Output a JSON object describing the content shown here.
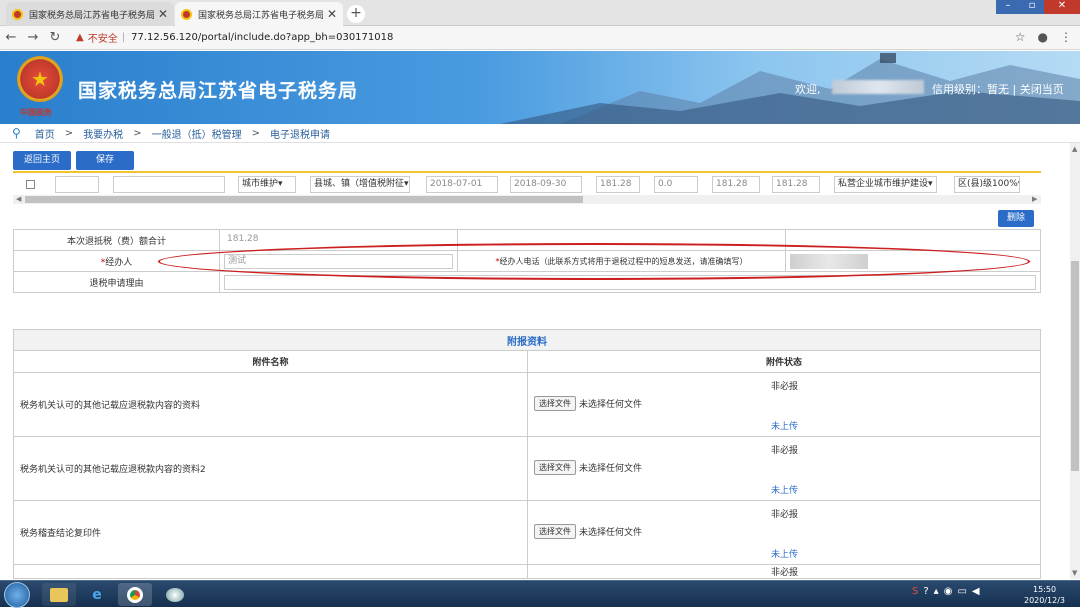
{
  "browser": {
    "tabs": [
      {
        "title": "国家税务总局江苏省电子税务局",
        "active": false
      },
      {
        "title": "国家税务总局江苏省电子税务局",
        "active": true
      }
    ],
    "new_tab_label": "+",
    "security_label": "不安全",
    "url": "77.12.56.120/portal/include.do?app_bh=030171018"
  },
  "header": {
    "site_title": "国家税务总局江苏省电子税务局",
    "emblem_caption": "中国税务",
    "welcome": "欢迎,",
    "top_right": "信用级别：暂无 | 关闭当页"
  },
  "breadcrumb": [
    "首页",
    "我要办税",
    "一般退（抵）税管理",
    "电子退税申请"
  ],
  "toolbar": {
    "back_label": "返回主页",
    "save_label": "保存",
    "delete_label": "删除"
  },
  "data_row": {
    "tax_type": "城市维护▾",
    "region": "县城、镇（增值税附征▾",
    "start_date": "2018-07-01",
    "end_date": "2018-09-30",
    "amount1": "181.28",
    "amount2": "0.0",
    "amount3": "181.28",
    "amount4": "181.28",
    "item": "私营企业城市维护建设▾",
    "level": "区(县)级100%▾"
  },
  "summary": {
    "total_label": "本次退抵税（费）额合计",
    "total_value": "181.28",
    "handler_label": "经办人",
    "handler_value": "测试",
    "phone_label": "经办人电话（此联系方式将用于退税过程中的短息发送，请准确填写）",
    "reason_label": "退税申请理由"
  },
  "attachments": {
    "caption": "附报资料",
    "col_name": "附件名称",
    "col_status": "附件状态",
    "rows": [
      {
        "name": "税务机关认可的其他记载应退税款内容的资料",
        "optional": "非必报",
        "choose": "选择文件",
        "no_file": "未选择任何文件",
        "status": "未上传"
      },
      {
        "name": "税务机关认可的其他记载应退税款内容的资料2",
        "optional": "非必报",
        "choose": "选择文件",
        "no_file": "未选择任何文件",
        "status": "未上传"
      },
      {
        "name": "税务稽查结论复印件",
        "optional": "非必报",
        "choose": "选择文件",
        "no_file": "未选择任何文件",
        "status": "未上传"
      }
    ],
    "partial_optional": "非必报"
  },
  "taskbar": {
    "time": "15:50",
    "date": "2020/12/3"
  },
  "colors": {
    "brand_blue": "#2a6cc8",
    "highlight_red": "#cc1f1f",
    "accent_yellow": "#f1c232"
  }
}
